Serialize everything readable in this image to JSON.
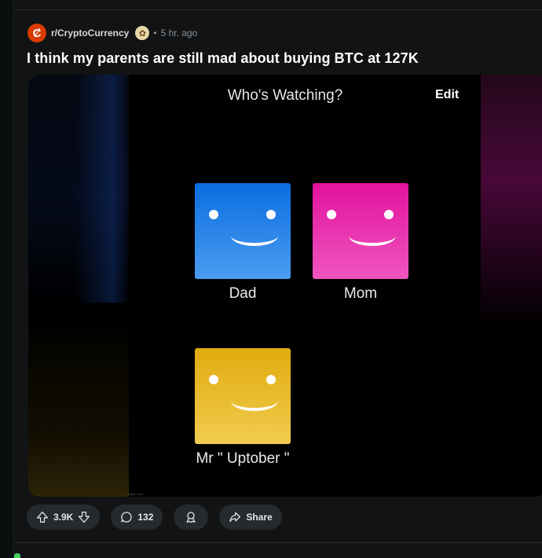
{
  "post": {
    "subreddit": "r/CryptoCurrency",
    "subreddit_icon_letter": "Ȼ",
    "separator": "•",
    "time": "5 hr. ago",
    "title": "I think my parents are still mad about buying BTC at 127K"
  },
  "meme": {
    "header": "Who's Watching?",
    "edit_label": "Edit",
    "profiles": [
      {
        "name": "Dad",
        "color": "#0a6ee0"
      },
      {
        "name": "Mom",
        "color": "#e2129e"
      },
      {
        "name": "Mr \" Uptober \"",
        "color": "#e0ab0f"
      }
    ],
    "watermark": "imgflip.com"
  },
  "actions": {
    "votes": "3.9K",
    "comments": "132",
    "share": "Share"
  },
  "icons": [
    "upvote-icon",
    "downvote-icon",
    "comment-icon",
    "award-icon",
    "share-icon",
    "flair-icon"
  ],
  "colors": {
    "subreddit_accent": "#d93a00",
    "card_bg": "#111314",
    "pill_bg": "#272a2c"
  }
}
